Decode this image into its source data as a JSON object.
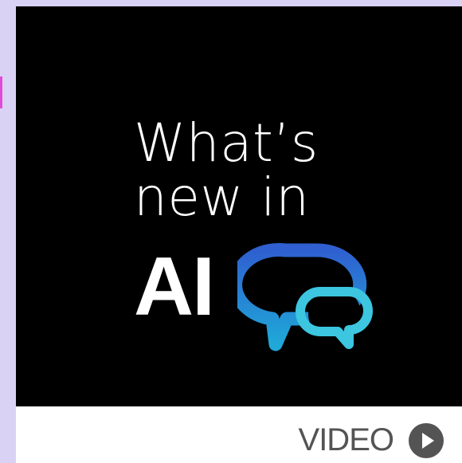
{
  "thumbnail": {
    "headline_line1": "What’s",
    "headline_line2": "new in",
    "headline_ai": "AI"
  },
  "footer": {
    "label": "VIDEO",
    "play_icon": "play-circle-icon"
  },
  "icons": {
    "chat": "chat-bubbles-icon"
  },
  "colors": {
    "background": "#000000",
    "text": "#ffffff",
    "bubble_large_top": "#2f5fd0",
    "bubble_large_bottom": "#1fa8d8",
    "bubble_small": "#3cc6e0",
    "footer_text": "#545454",
    "page_bg": "#d9d2f5",
    "accent": "#e14ad6"
  }
}
